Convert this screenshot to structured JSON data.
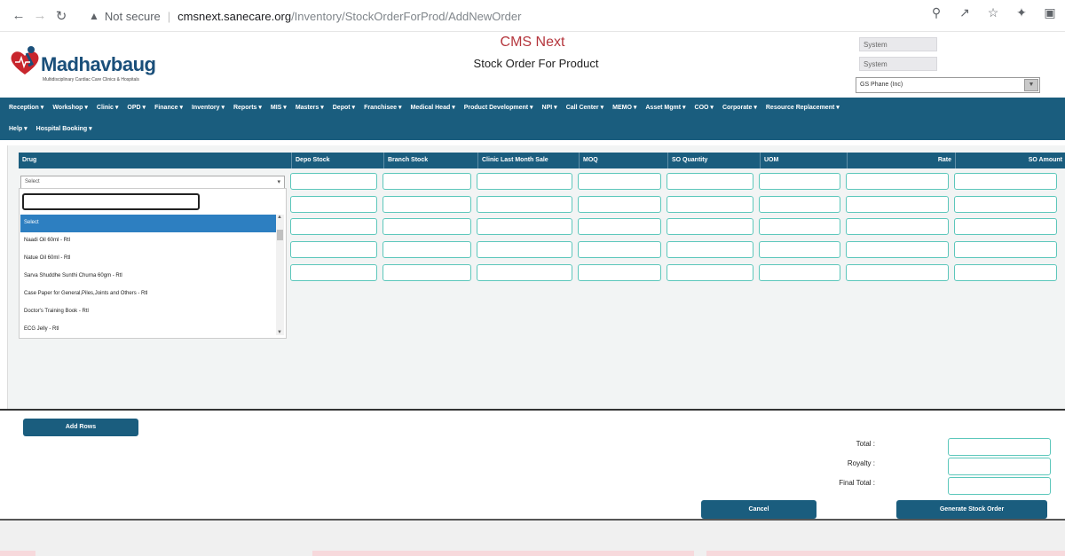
{
  "browser": {
    "security_label": "Not secure",
    "url_host": "cmsnext.sanecare.org",
    "url_path": "/Inventory/StockOrderForProd/AddNewOrder"
  },
  "header": {
    "logo_text": "Madhavbaug",
    "logo_tagline": "Multidisciplinary Cardiac Care Clinics & Hospitals",
    "app_title": "CMS Next",
    "page_title": "Stock Order For Product",
    "system_field_1": "System",
    "system_field_2": "System",
    "clinic_select": "GS Phane (Inc)"
  },
  "nav": {
    "row1": [
      "Reception",
      "Workshop",
      "Clinic",
      "OPD",
      "Finance",
      "Inventory",
      "Reports",
      "MIS",
      "Masters",
      "Depot",
      "Franchisee",
      "Medical Head",
      "Product Development",
      "NPI",
      "Call Center",
      "MEMO",
      "Asset Mgmt",
      "COO",
      "Corporate",
      "Resource Replacement"
    ],
    "row2": [
      "Help",
      "Hospital Booking"
    ]
  },
  "grid": {
    "headers": [
      "Drug",
      "Depo Stock",
      "Branch Stock",
      "Clinic Last Month Sale",
      "MOQ",
      "SO Quantity",
      "UOM",
      "Rate",
      "SO Amount"
    ],
    "drug_select_value": "Select"
  },
  "dropdown": {
    "items": [
      "Select",
      "Naadi Oil 60ml - Rtl",
      "Natue Oil 60ml - Rtl",
      "Sarva Shuddhe Sunthi Churna 60gm - Rtl",
      "Case Paper for General,Piles,Joints and Others - Rtl",
      "Doctor's Training Book - Rtl",
      "ECG Jelly - Rtl"
    ]
  },
  "actions": {
    "add_rows": "Add Rows",
    "cancel": "Cancel",
    "generate": "Generate Stock Order"
  },
  "totals": {
    "total_label": "Total :",
    "royalty_label": "Royalty :",
    "final_total_label": "Final Total :"
  },
  "colors": {
    "brand_primary": "#1a5d7e",
    "title_red": "#b5363d",
    "input_border": "#5cc7bb",
    "selected_item": "#2d7fc1"
  }
}
